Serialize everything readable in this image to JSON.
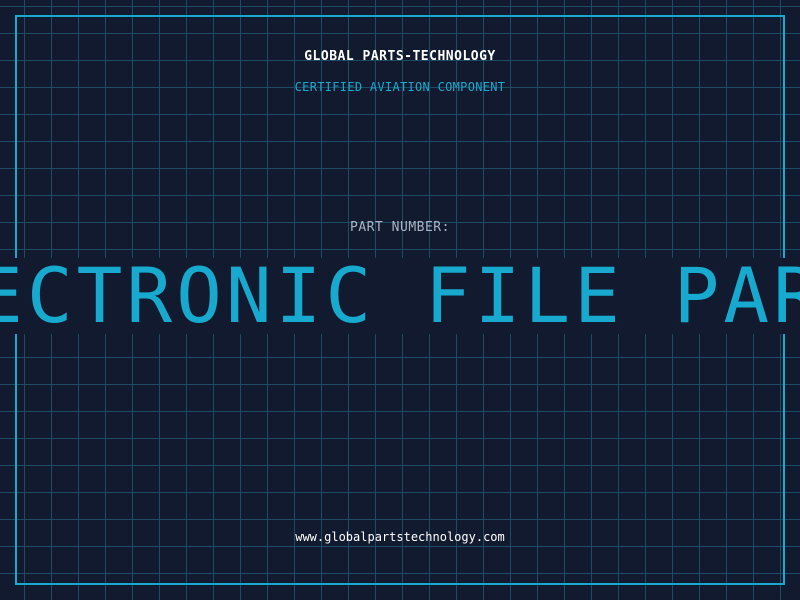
{
  "header": {
    "company": "GLOBAL PARTS-TECHNOLOGY",
    "tagline": "CERTIFIED AVIATION COMPONENT"
  },
  "part": {
    "label": "PART NUMBER:",
    "value": "ELECTRONIC FILE PARTS"
  },
  "footer": {
    "website": "www.globalpartstechnology.com"
  },
  "colors": {
    "background": "#111a2e",
    "grid": "#1f4a63",
    "accent": "#18a9cf",
    "text": "#ffffff",
    "muted": "#aab4c4"
  }
}
